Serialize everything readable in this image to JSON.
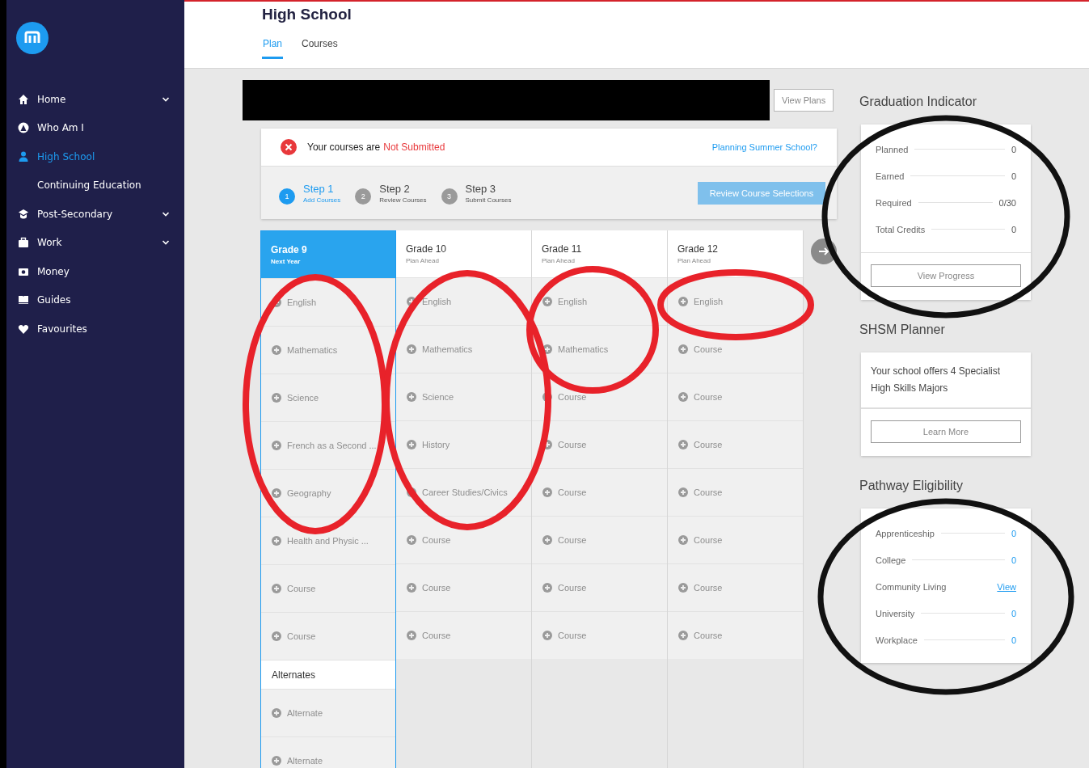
{
  "sidebar": {
    "items": [
      {
        "label": "Home",
        "selected": false,
        "expandable": true
      },
      {
        "label": "Who Am I",
        "selected": false,
        "expandable": false
      },
      {
        "label": "High School",
        "selected": true,
        "expandable": false,
        "children": [
          {
            "label": "Continuing Education",
            "selected": false,
            "expandable": false
          }
        ]
      },
      {
        "label": "Post-Secondary",
        "selected": false,
        "expandable": true
      },
      {
        "label": "Work",
        "selected": false,
        "expandable": true
      },
      {
        "label": "Money",
        "selected": false,
        "expandable": false
      },
      {
        "label": "Guides",
        "selected": false,
        "expandable": false
      },
      {
        "label": "Favourites",
        "selected": false,
        "expandable": false
      }
    ]
  },
  "header": {
    "title": "High School",
    "tabs": [
      {
        "label": "Plan",
        "selected": true
      },
      {
        "label": "Courses",
        "selected": false
      }
    ]
  },
  "plans": {
    "button": "View Plans"
  },
  "status": {
    "text": "Your courses are",
    "value": "Not Submitted",
    "link": "Planning Summer School?",
    "steps": [
      {
        "number": "1",
        "title": "Step 1",
        "subtitle": "Add Courses",
        "selected": true
      },
      {
        "number": "2",
        "title": "Step 2",
        "subtitle": "Review Courses",
        "selected": false
      },
      {
        "number": "3",
        "title": "Step 3",
        "subtitle": "Submit Courses",
        "selected": false
      }
    ],
    "review_button": {
      "label": "Review Course Selections",
      "disabled": true
    }
  },
  "grades": [
    {
      "title": "Grade 9",
      "subtitle": "Next Year",
      "selected": true,
      "courses": [
        "English",
        "Mathematics",
        "Science",
        "French as a Second ...",
        "Geography",
        "Health and Physic ...",
        "Course",
        "Course"
      ],
      "alternates_title": "Alternates",
      "alternates": [
        "Alternate",
        "Alternate"
      ]
    },
    {
      "title": "Grade 10",
      "subtitle": "Plan Ahead",
      "selected": false,
      "courses": [
        "English",
        "Mathematics",
        "Science",
        "History",
        "Career Studies/Civics",
        "Course",
        "Course",
        "Course"
      ]
    },
    {
      "title": "Grade 11",
      "subtitle": "Plan Ahead",
      "selected": false,
      "courses": [
        "English",
        "Mathematics",
        "Course",
        "Course",
        "Course",
        "Course",
        "Course",
        "Course"
      ]
    },
    {
      "title": "Grade 12",
      "subtitle": "Plan Ahead",
      "selected": false,
      "courses": [
        "English",
        "Course",
        "Course",
        "Course",
        "Course",
        "Course",
        "Course",
        "Course"
      ]
    }
  ],
  "graduation_indicator": {
    "title": "Graduation Indicator",
    "rows": [
      {
        "label": "Planned",
        "value": "0"
      },
      {
        "label": "Earned",
        "value": "0"
      },
      {
        "label": "Required",
        "value": "0/30"
      },
      {
        "label": "Total Credits",
        "value": "0"
      }
    ],
    "button": "View Progress"
  },
  "shsm_planner": {
    "title": "SHSM Planner",
    "text": "Your school offers 4 Specialist High Skills Majors",
    "button": "Learn More"
  },
  "pathway_eligibility": {
    "title": "Pathway Eligibility",
    "rows": [
      {
        "label": "Apprenticeship",
        "value": "0",
        "kind": "count"
      },
      {
        "label": "College",
        "value": "0",
        "kind": "count"
      },
      {
        "label": "Community Living",
        "value": "View",
        "kind": "link"
      },
      {
        "label": "University",
        "value": "0",
        "kind": "count"
      },
      {
        "label": "Workplace",
        "value": "0",
        "kind": "count"
      }
    ]
  },
  "annotations": [
    {
      "color": "#e8222a"
    },
    {
      "color": "#e8222a"
    },
    {
      "color": "#e8222a"
    },
    {
      "color": "#e8222a"
    },
    {
      "color": "#111111"
    },
    {
      "color": "#111111"
    }
  ]
}
